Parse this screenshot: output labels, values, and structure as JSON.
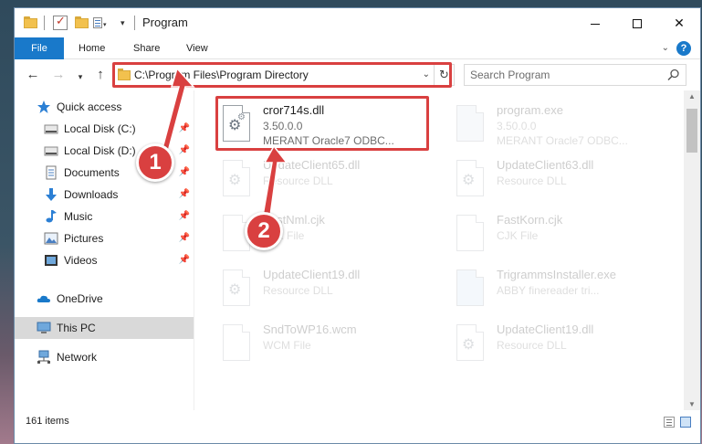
{
  "window": {
    "title": "Program",
    "minimize_glyph": "",
    "maximize_glyph": "",
    "close_glyph": "✕"
  },
  "ribbon": {
    "tabs": [
      "File",
      "Home",
      "Share",
      "View"
    ],
    "help_glyph": "?"
  },
  "nav": {
    "back_glyph": "←",
    "forward_glyph": "→",
    "up_glyph": "↑",
    "address": "C:\\Program Files\\Program Directory",
    "search_placeholder": "Search Program"
  },
  "sidebar": {
    "items": [
      {
        "label": "Quick access",
        "icon": "star-icon",
        "pinned": false
      },
      {
        "label": "Local Disk (C:)",
        "icon": "drive-icon",
        "pinned": true
      },
      {
        "label": "Local Disk (D:)",
        "icon": "drive-icon",
        "pinned": true
      },
      {
        "label": "Documents",
        "icon": "documents-icon",
        "pinned": true
      },
      {
        "label": "Downloads",
        "icon": "download-icon",
        "pinned": true
      },
      {
        "label": "Music",
        "icon": "music-icon",
        "pinned": true
      },
      {
        "label": "Pictures",
        "icon": "pictures-icon",
        "pinned": true
      },
      {
        "label": "Videos",
        "icon": "videos-icon",
        "pinned": true
      },
      {
        "label": "OneDrive",
        "icon": "cloud-icon",
        "pinned": false
      },
      {
        "label": "This PC",
        "icon": "computer-icon",
        "pinned": false,
        "selected": true
      },
      {
        "label": "Network",
        "icon": "network-icon",
        "pinned": false
      }
    ]
  },
  "files": [
    {
      "name": "cror714s.dll",
      "meta1": "3.50.0.0",
      "meta2": "MERANT Oracle7 ODBC...",
      "highlighted": true
    },
    {
      "name": "program.exe",
      "meta1": "3.50.0.0",
      "meta2": "MERANT Oracle7 ODBC...",
      "faded": true
    },
    {
      "name": "UpdateClient65.dll",
      "meta1": "Resource DLL",
      "meta2": "",
      "faded": true
    },
    {
      "name": "UpdateClient63.dll",
      "meta1": "Resource DLL",
      "meta2": "",
      "faded": true
    },
    {
      "name": "FastNml.cjk",
      "meta1": "CJK File",
      "meta2": "",
      "faded": true
    },
    {
      "name": "FastKorn.cjk",
      "meta1": "CJK File",
      "meta2": "",
      "faded": true
    },
    {
      "name": "UpdateClient19.dll",
      "meta1": "Resource DLL",
      "meta2": "",
      "faded": true
    },
    {
      "name": "TrigrammsInstaller.exe",
      "meta1": "ABBY finereader tri...",
      "meta2": "",
      "faded": true
    },
    {
      "name": "SndToWP16.wcm",
      "meta1": "WCM File",
      "meta2": "",
      "faded": true
    },
    {
      "name": "UpdateClient19.dll",
      "meta1": "Resource DLL",
      "meta2": "",
      "faded": true
    }
  ],
  "status": {
    "item_count": "161 items"
  },
  "annotations": {
    "badge1": "1",
    "badge2": "2",
    "color": "#d94040"
  },
  "colors": {
    "accent": "#1979ca",
    "selection": "#cce8ff"
  }
}
